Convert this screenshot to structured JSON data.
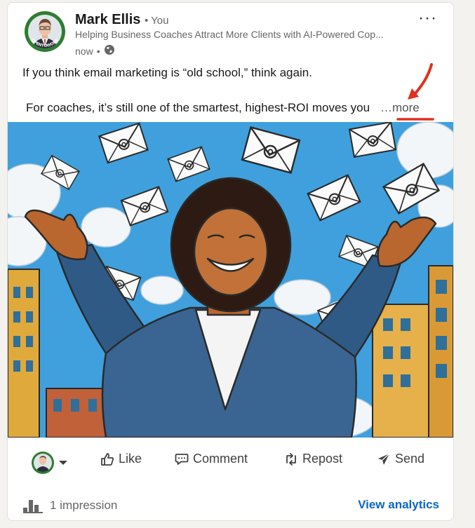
{
  "post": {
    "author": {
      "name": "Mark Ellis",
      "relation": "• You",
      "headline": "Helping Business Coaches Attract More Clients with AI-Powered Cop...",
      "timestamp": "now",
      "visibility_icon": "globe-icon",
      "avatar_badge": "OPENTOWORK"
    },
    "text_line1": "If you think email marketing is “old school,” think again.",
    "text_line2": "For coaches, it’s still one of the smartest, highest-ROI moves you",
    "more_label": "…more",
    "menu_label": "···"
  },
  "actions": {
    "like": "Like",
    "comment": "Comment",
    "repost": "Repost",
    "send": "Send"
  },
  "footer": {
    "impressions": "1 impression",
    "analytics": "View analytics"
  },
  "colors": {
    "accent": "#0a66c2",
    "annotation": "#e0301e",
    "open_to_work": "#2e7d32"
  }
}
